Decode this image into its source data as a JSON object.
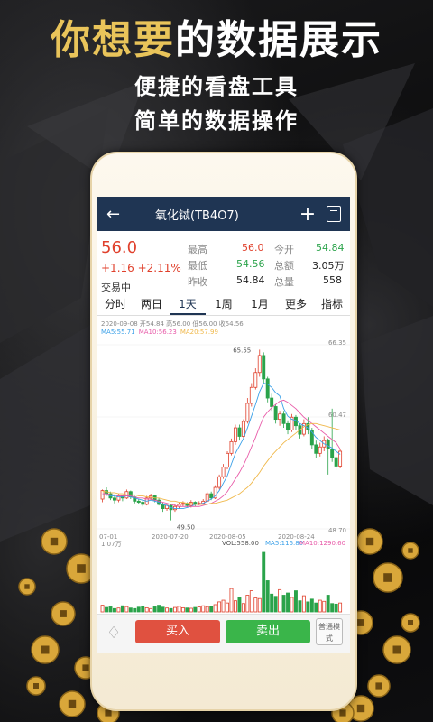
{
  "headline": {
    "part1": "你想要",
    "part2": "的数据展示"
  },
  "subtitle1": "便捷的看盘工具",
  "subtitle2": "简单的数据操作",
  "navbar": {
    "back_icon": "back-arrow-icon",
    "title": "氧化铽(TB4O7)",
    "add_icon": "plus-icon",
    "doc_icon": "document-icon"
  },
  "quote": {
    "price": "56.0",
    "change": "+1.16 +2.11%",
    "state": "交易中",
    "high_label": "最高",
    "high": "56.0",
    "open_label": "今开",
    "open": "54.84",
    "low_label": "最低",
    "low": "54.56",
    "amount_label": "总额",
    "amount": "3.05万",
    "prev_label": "昨收",
    "prev": "54.84",
    "volume_label": "总量",
    "volume": "558"
  },
  "tabs": [
    "分时",
    "两日",
    "1天",
    "1周",
    "1月",
    "更多",
    "指标"
  ],
  "active_tab": "1天",
  "chart_info": {
    "line1": "2020-09-08 开54.84 高56.00 低56.00 收54.56",
    "ma5": "MA5:55.71",
    "ma10": "MA10:56.23",
    "ma20": "MA20:57.99"
  },
  "chart_labels": {
    "high_marker": "65.55",
    "low_marker": "49.50",
    "y_top": "66.35",
    "y_mid": "60.47",
    "y_bottom": "48.70",
    "x_dates": [
      "07-01",
      "2020-07-20",
      "2020-08-05",
      "2020-08-24"
    ]
  },
  "volume_info": {
    "max": "1.07万",
    "vol": "VOL:558.00",
    "ma5": "MA5:116.80",
    "ma10": "MA10:1290.60"
  },
  "bottom": {
    "bell_icon": "bell-icon",
    "buy": "买入",
    "sell": "卖出",
    "mode": "普通模式"
  },
  "colors": {
    "up": "#e0402c",
    "down": "#2aa34a",
    "nav": "#1f3553",
    "gold": "#e9c45a",
    "ma5": "#3aa0e8",
    "ma10": "#e85aa8",
    "ma20": "#f0b84a"
  },
  "chart_data": {
    "type": "candlestick",
    "ylim": [
      48.7,
      66.35
    ],
    "candles": [
      [
        51.5,
        52.3,
        51.2,
        52.4
      ],
      [
        52.3,
        52.0,
        51.8,
        52.6
      ],
      [
        52.0,
        51.6,
        51.4,
        52.2
      ],
      [
        51.6,
        51.4,
        51.1,
        51.9
      ],
      [
        51.4,
        51.8,
        51.2,
        52.0
      ],
      [
        51.8,
        51.6,
        51.3,
        51.9
      ],
      [
        51.6,
        52.2,
        51.5,
        52.4
      ],
      [
        52.2,
        51.7,
        51.5,
        52.3
      ],
      [
        51.7,
        51.3,
        51.1,
        51.8
      ],
      [
        51.3,
        51.2,
        51.0,
        51.5
      ],
      [
        51.2,
        51.0,
        50.8,
        51.4
      ],
      [
        51.0,
        51.6,
        50.9,
        51.8
      ],
      [
        51.6,
        51.8,
        51.4,
        52.0
      ],
      [
        51.8,
        51.4,
        51.2,
        51.9
      ],
      [
        51.4,
        51.0,
        50.9,
        51.6
      ],
      [
        51.0,
        50.6,
        50.3,
        51.2
      ],
      [
        50.6,
        50.9,
        50.4,
        51.1
      ],
      [
        50.9,
        50.5,
        49.5,
        51.0
      ],
      [
        50.5,
        50.8,
        50.3,
        51.0
      ],
      [
        50.8,
        51.0,
        50.6,
        51.2
      ],
      [
        51.0,
        51.1,
        50.8,
        51.3
      ],
      [
        51.1,
        50.9,
        50.7,
        51.2
      ],
      [
        50.9,
        51.2,
        50.7,
        51.4
      ],
      [
        51.2,
        51.0,
        50.8,
        51.3
      ],
      [
        51.0,
        51.1,
        50.9,
        51.3
      ],
      [
        51.1,
        51.3,
        51.0,
        51.5
      ],
      [
        51.3,
        52.0,
        51.2,
        52.2
      ],
      [
        52.0,
        51.6,
        51.4,
        52.2
      ],
      [
        51.6,
        52.6,
        51.5,
        52.8
      ],
      [
        52.6,
        53.6,
        52.4,
        53.8
      ],
      [
        53.6,
        54.5,
        53.4,
        54.8
      ],
      [
        54.5,
        55.8,
        54.3,
        56.0
      ],
      [
        55.8,
        56.9,
        55.6,
        57.2
      ],
      [
        56.9,
        58.2,
        56.6,
        58.5
      ],
      [
        58.2,
        57.4,
        57.0,
        58.5
      ],
      [
        57.4,
        58.8,
        57.2,
        59.0
      ],
      [
        58.8,
        60.5,
        58.6,
        61.0
      ],
      [
        60.5,
        62.0,
        60.2,
        62.4
      ],
      [
        62.0,
        63.4,
        61.8,
        63.8
      ],
      [
        63.4,
        65.0,
        63.0,
        65.55
      ],
      [
        65.0,
        62.8,
        62.4,
        65.3
      ],
      [
        62.8,
        61.0,
        60.6,
        63.0
      ],
      [
        61.0,
        60.2,
        59.8,
        61.4
      ],
      [
        60.2,
        59.0,
        58.6,
        60.4
      ],
      [
        59.0,
        59.5,
        58.4,
        59.8
      ],
      [
        59.5,
        58.6,
        58.2,
        59.8
      ],
      [
        58.6,
        58.0,
        57.6,
        58.9
      ],
      [
        58.0,
        59.2,
        57.8,
        59.5
      ],
      [
        59.2,
        58.4,
        58.0,
        59.4
      ],
      [
        58.4,
        57.6,
        57.2,
        58.6
      ],
      [
        57.6,
        58.6,
        57.4,
        59.0
      ],
      [
        58.6,
        58.0,
        57.6,
        59.2
      ],
      [
        58.0,
        56.6,
        56.2,
        58.2
      ],
      [
        56.6,
        55.8,
        55.4,
        57.0
      ],
      [
        55.8,
        56.4,
        55.5,
        56.8
      ],
      [
        56.4,
        57.0,
        56.0,
        57.4
      ],
      [
        57.0,
        56.2,
        53.8,
        57.2
      ],
      [
        56.2,
        55.4,
        55.0,
        60.0
      ],
      [
        55.4,
        54.6,
        54.2,
        57.0
      ],
      [
        54.6,
        56.0,
        54.4,
        56.2
      ]
    ],
    "volumes": [
      120,
      80,
      90,
      60,
      70,
      110,
      95,
      70,
      60,
      85,
      100,
      75,
      60,
      90,
      120,
      85,
      70,
      60,
      80,
      100,
      75,
      70,
      65,
      80,
      90,
      110,
      95,
      100,
      130,
      180,
      210,
      160,
      420,
      200,
      260,
      150,
      300,
      380,
      250,
      240,
      1070,
      560,
      320,
      280,
      400,
      300,
      340,
      260,
      380,
      200,
      290,
      180,
      230,
      160,
      210,
      190,
      300,
      150,
      140,
      160
    ],
    "ma5": [
      51.9,
      51.9,
      51.8,
      51.8,
      51.7,
      51.7,
      51.8,
      51.7,
      51.6,
      51.5,
      51.4,
      51.3,
      51.4,
      51.3,
      51.2,
      51.0,
      50.9,
      50.7,
      50.6,
      50.6,
      50.6,
      50.7,
      50.8,
      51.0,
      51.0,
      51.1,
      51.3,
      51.5,
      51.8,
      52.3,
      53.0,
      53.7,
      54.8,
      55.8,
      56.5,
      57.2,
      58.2,
      59.3,
      60.4,
      61.6,
      62.4,
      62.3,
      62.0,
      61.5,
      61.2,
      60.0,
      59.3,
      59.0,
      58.9,
      58.6,
      58.4,
      58.2,
      57.8,
      57.3,
      57.0,
      56.7,
      56.5,
      56.3,
      56.0,
      55.7
    ],
    "ma10": [
      52.0,
      52.0,
      51.9,
      51.9,
      51.8,
      51.8,
      51.8,
      51.8,
      51.7,
      51.6,
      51.6,
      51.5,
      51.5,
      51.4,
      51.3,
      51.2,
      51.1,
      51.0,
      50.9,
      50.8,
      50.8,
      50.8,
      50.8,
      50.8,
      50.8,
      50.9,
      51.0,
      51.1,
      51.3,
      51.5,
      51.8,
      52.2,
      52.8,
      53.4,
      54.0,
      54.7,
      55.5,
      56.4,
      57.3,
      58.3,
      59.2,
      59.7,
      60.1,
      60.4,
      60.7,
      60.8,
      60.6,
      60.3,
      60.0,
      59.6,
      59.2,
      58.9,
      58.6,
      58.3,
      58.0,
      57.7,
      57.4,
      57.1,
      56.8,
      56.2
    ],
    "ma20": [
      52.2,
      52.2,
      52.1,
      52.1,
      52.0,
      52.0,
      51.9,
      51.9,
      51.9,
      51.8,
      51.8,
      51.7,
      51.7,
      51.6,
      51.6,
      51.5,
      51.4,
      51.3,
      51.3,
      51.2,
      51.2,
      51.1,
      51.1,
      51.0,
      51.0,
      51.0,
      51.0,
      51.1,
      51.1,
      51.2,
      51.3,
      51.4,
      51.6,
      51.8,
      52.0,
      52.3,
      52.6,
      53.0,
      53.5,
      54.0,
      54.6,
      55.1,
      55.6,
      56.0,
      56.4,
      56.8,
      57.1,
      57.4,
      57.7,
      58.0,
      58.3,
      58.5,
      58.6,
      58.6,
      58.5,
      58.4,
      58.3,
      58.2,
      58.1,
      58.0
    ]
  }
}
